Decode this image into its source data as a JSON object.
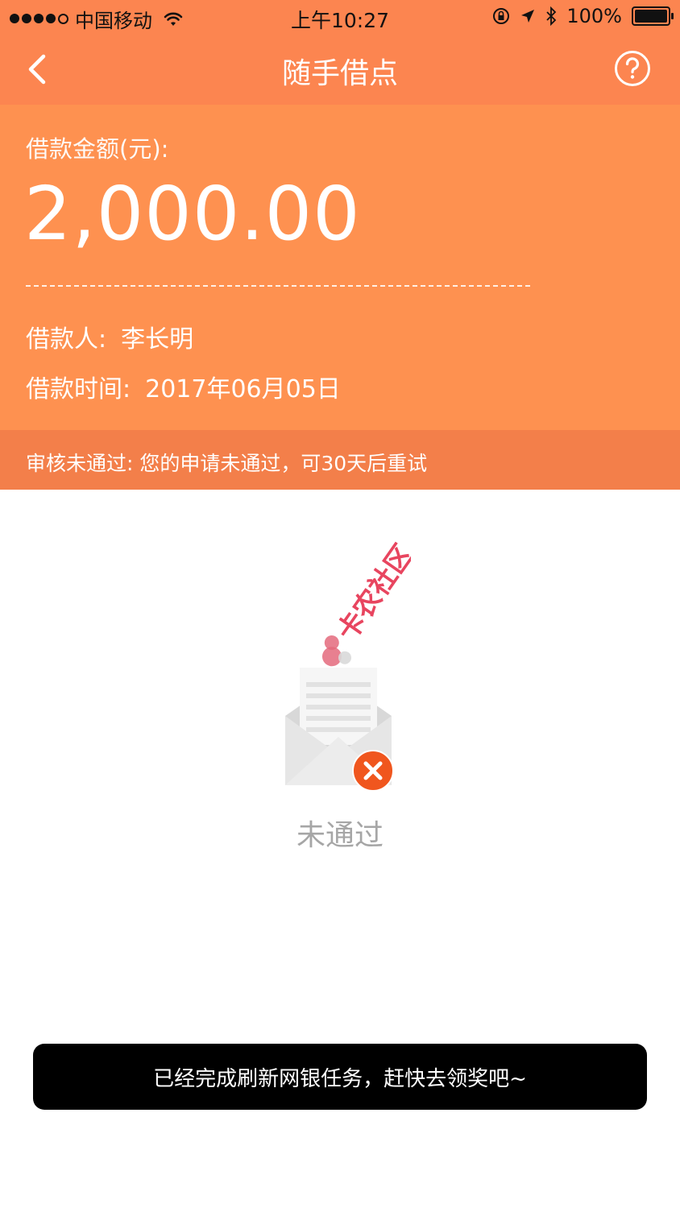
{
  "status_bar": {
    "carrier": "中国移动",
    "time": "上午10:27",
    "battery": "100%",
    "signal_bars": 4,
    "icons": [
      "signal-dots-icon",
      "wifi-icon",
      "rotation-lock-icon",
      "location-arrow-icon",
      "bluetooth-icon",
      "battery-icon"
    ]
  },
  "nav": {
    "title": "随手借点",
    "icons": [
      "back-chevron-icon",
      "help-question-icon"
    ]
  },
  "loan": {
    "amount_label": "借款金额(元):",
    "amount": "2,000.00",
    "borrower_label": "借款人:",
    "borrower": "李长明",
    "date_label": "借款时间:",
    "date": "2017年06月05日"
  },
  "notice": {
    "text": "审核未通过: 您的申请未通过，可30天后重试"
  },
  "result": {
    "status": "未通过",
    "watermark": "卡农社区",
    "icons": [
      "envelope-rejected-icon",
      "close-x-icon"
    ]
  },
  "toast": {
    "text": "已经完成刷新网银任务，赶快去领奖吧~"
  },
  "colors": {
    "nav": "#fc8550",
    "panel": "#fe9150",
    "notice": "#f37f4a",
    "reject": "#f0561e",
    "muted_text": "#a6a6a6",
    "toast_bg": "#000000"
  }
}
